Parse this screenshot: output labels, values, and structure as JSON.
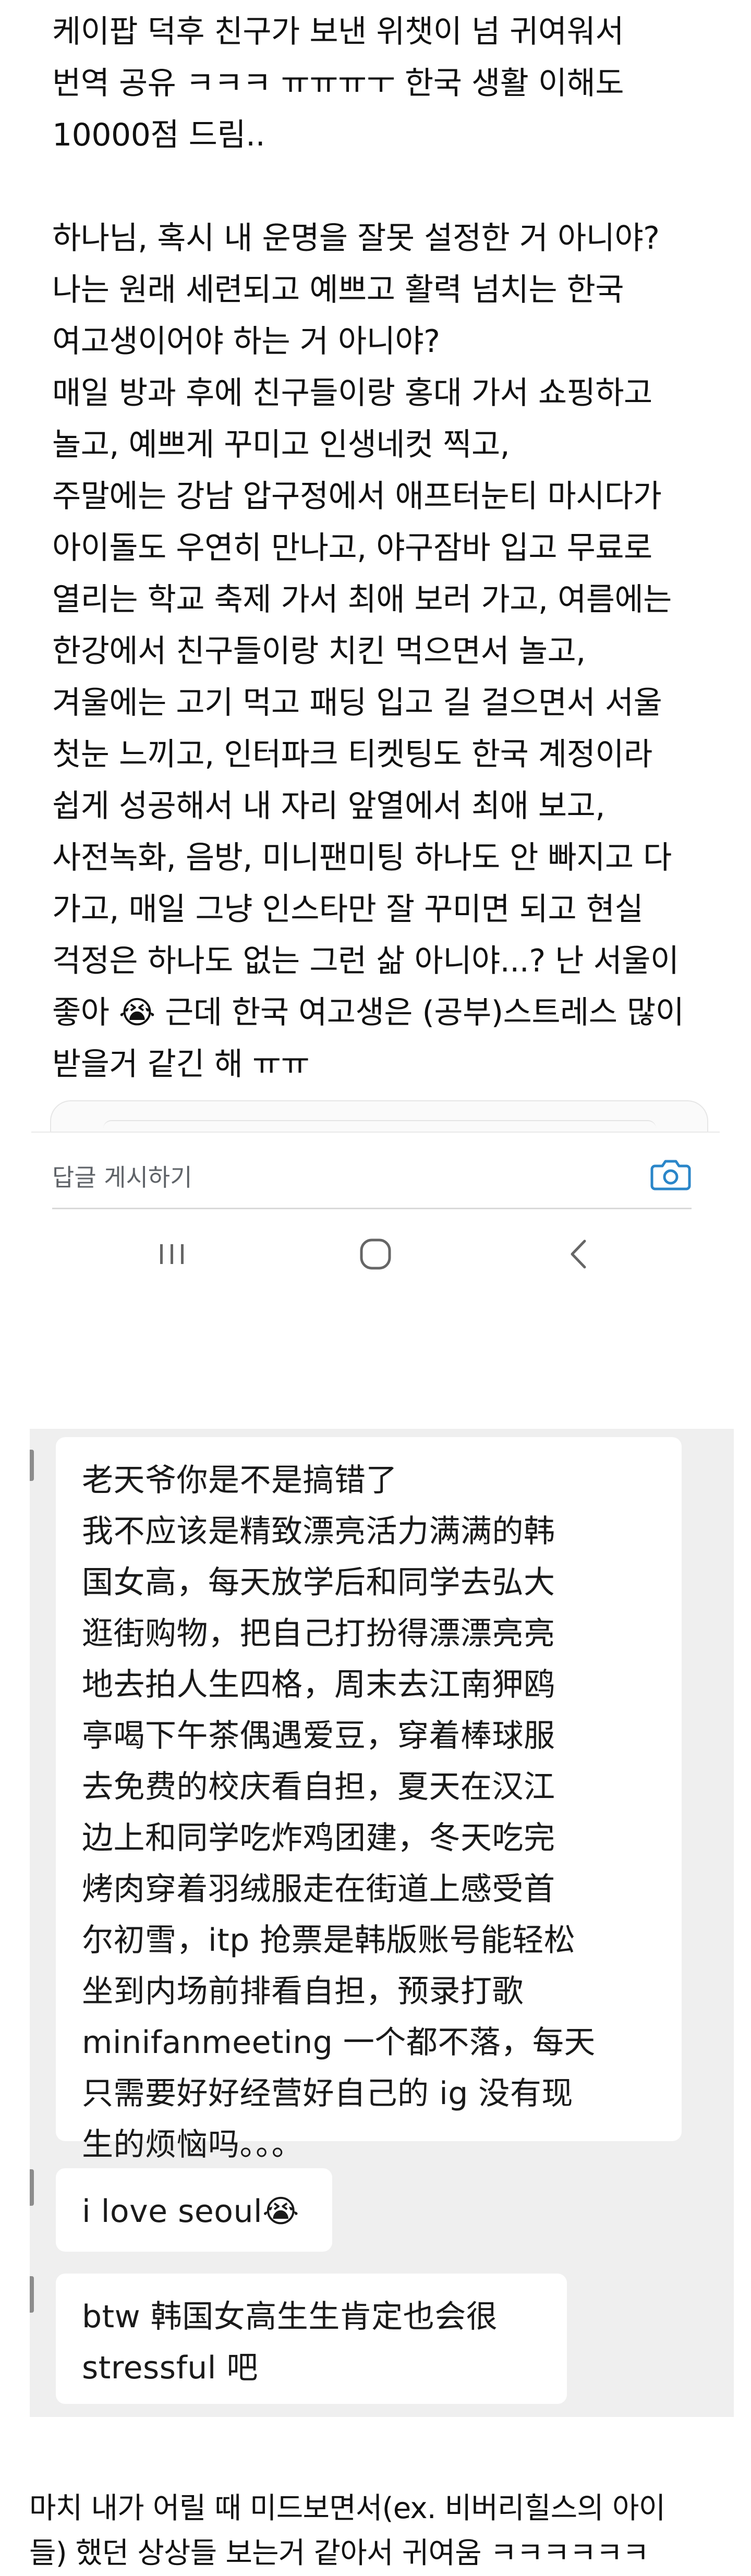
{
  "post": {
    "lines": [
      "케이팝 덕후 친구가 보낸 위챗이 넘 귀여워서",
      "번역 공유 ㅋㅋㅋ ㅠㅠㅠㅜ 한국 생활 이해도",
      "10000점 드림..",
      "",
      "하나님, 혹시 내 운명을 잘못 설정한 거 아니야?",
      "나는 원래 세련되고 예쁘고 활력 넘치는 한국",
      "여고생이어야 하는 거 아니야?",
      "매일 방과 후에 친구들이랑 홍대 가서 쇼핑하고",
      "놀고, 예쁘게 꾸미고 인생네컷 찍고,",
      "주말에는 강남 압구정에서 애프터눈티 마시다가",
      "아이돌도 우연히 만나고, 야구잠바 입고 무료로",
      "열리는 학교 축제 가서 최애 보러 가고, 여름에는",
      "한강에서 친구들이랑 치킨 먹으면서 놀고,",
      "겨울에는 고기 먹고 패딩 입고 길 걸으면서 서울",
      "첫눈 느끼고, 인터파크 티켓팅도 한국 계정이라",
      "쉽게 성공해서 내 자리 앞열에서 최애 보고,",
      "사전녹화, 음방, 미니팬미팅 하나도 안 빠지고 다",
      "가고, 매일 그냥 인스타만 잘 꾸미면 되고 현실",
      "걱정은 하나도 없는 그런 삶 아니야...? 난 서울이",
      "좋아 😭 근데 한국 여고생은 (공부)스트레스 많이",
      "받을거 같긴 해 ㅠㅠ"
    ]
  },
  "app": {
    "reply_label": "답글 게시하기",
    "icons": {
      "camera": "camera-icon",
      "recents": "recent-apps-icon",
      "home": "home-icon",
      "back": "back-icon"
    }
  },
  "chat": {
    "messages": [
      {
        "lines": [
          "老天爷你是不是搞错了",
          "我不应该是精致漂亮活力满满的韩",
          "国女高，每天放学后和同学去弘大",
          "逛街购物，把自己打扮得漂漂亮亮",
          "地去拍人生四格，周末去江南狎鸥",
          "亭喝下午茶偶遇爱豆，穿着棒球服",
          "去免费的校庆看自担，夏天在汉江",
          "边上和同学吃炸鸡团建，冬天吃完",
          "烤肉穿着羽绒服走在街道上感受首",
          "尔初雪，itp 抢票是韩版账号能轻松",
          "坐到内场前排看自担，预录打歌",
          "minifanmeeting 一个都不落，每天",
          "只需要好好经营好自己的 ig 没有现",
          "生的烦恼吗。。。"
        ]
      },
      {
        "lines": [
          "i love seoul😭"
        ]
      },
      {
        "lines": [
          "btw 韩国女高生生肯定也会很",
          "stressful 吧"
        ]
      }
    ]
  },
  "comment": {
    "lines": [
      "마치 내가 어릴 때 미드보면서(ex. 비버리힐스의 아이",
      "들) 했던 상상들 보는거 같아서 귀여움 ㅋㅋㅋㅋㅋㅋ"
    ]
  }
}
